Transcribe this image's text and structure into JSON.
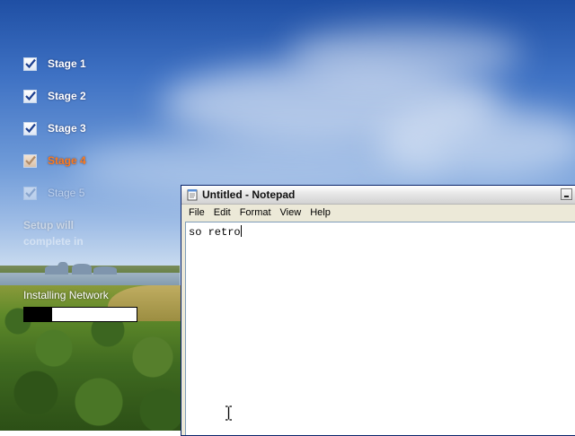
{
  "setup": {
    "stages": [
      {
        "label": "Stage 1",
        "state": "done"
      },
      {
        "label": "Stage 2",
        "state": "done"
      },
      {
        "label": "Stage 3",
        "state": "done"
      },
      {
        "label": "Stage 4",
        "state": "active"
      },
      {
        "label": "Stage 5",
        "state": "pending"
      }
    ],
    "remaining_label": "Setup will",
    "remaining_label_2": "complete in",
    "current_task": "Installing Network",
    "progress": 0.25
  },
  "notepad": {
    "title": "Untitled - Notepad",
    "icon": "notepad-icon",
    "menu": [
      "File",
      "Edit",
      "Format",
      "View",
      "Help"
    ],
    "content": "so retro"
  },
  "colors": {
    "active_stage": "#ff7a1a",
    "title_text": "#111111"
  }
}
